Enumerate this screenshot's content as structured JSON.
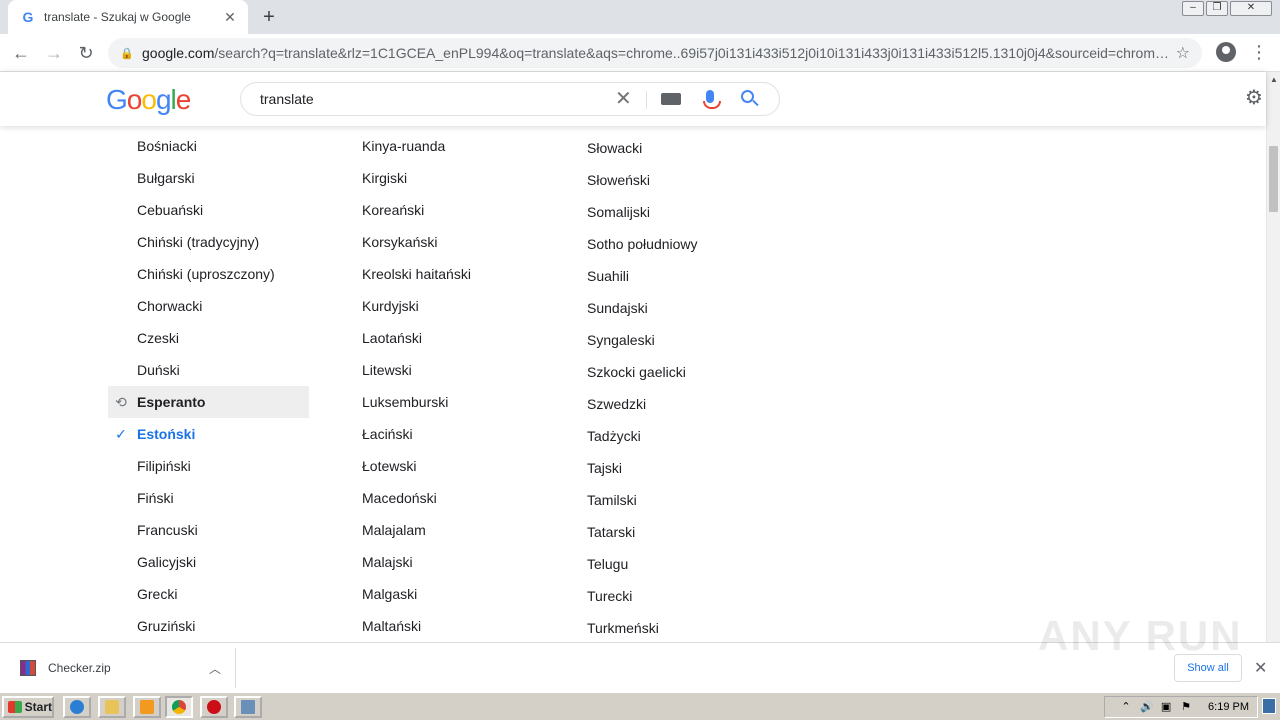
{
  "browser": {
    "tab_title": "translate - Szukaj w Google",
    "url_host": "google.com",
    "url_rest": "/search?q=translate&rlz=1C1GCEA_enPL994&oq=translate&aqs=chrome..69i57j0i131i433i512j0i10i131i433j0i131i433i512l5.1310j0j4&sourceid=chrom…",
    "window_controls": [
      "minimize",
      "restore",
      "close"
    ]
  },
  "search": {
    "query": "translate"
  },
  "languages": {
    "column1": [
      {
        "label": "Bośniacki"
      },
      {
        "label": "Bułgarski"
      },
      {
        "label": "Cebuański"
      },
      {
        "label": "Chiński (tradycyjny)"
      },
      {
        "label": "Chiński (uproszczony)"
      },
      {
        "label": "Chorwacki"
      },
      {
        "label": "Czeski"
      },
      {
        "label": "Duński"
      },
      {
        "label": "Esperanto",
        "state": "recent"
      },
      {
        "label": "Estoński",
        "state": "selected"
      },
      {
        "label": "Filipiński"
      },
      {
        "label": "Fiński"
      },
      {
        "label": "Francuski"
      },
      {
        "label": "Galicyjski"
      },
      {
        "label": "Grecki"
      },
      {
        "label": "Gruziński"
      }
    ],
    "column2": [
      {
        "label": "Kinya-ruanda"
      },
      {
        "label": "Kirgiski"
      },
      {
        "label": "Koreański"
      },
      {
        "label": "Korsykański"
      },
      {
        "label": "Kreolski haitański"
      },
      {
        "label": "Kurdyjski"
      },
      {
        "label": "Laotański"
      },
      {
        "label": "Litewski"
      },
      {
        "label": "Luksemburski"
      },
      {
        "label": "Łaciński"
      },
      {
        "label": "Łotewski"
      },
      {
        "label": "Macedoński"
      },
      {
        "label": "Malajalam"
      },
      {
        "label": "Malajski"
      },
      {
        "label": "Malgaski"
      },
      {
        "label": "Maltański"
      }
    ],
    "column3": [
      {
        "label": "Słowacki"
      },
      {
        "label": "Słoweński"
      },
      {
        "label": "Somalijski"
      },
      {
        "label": "Sotho południowy"
      },
      {
        "label": "Suahili"
      },
      {
        "label": "Sundajski"
      },
      {
        "label": "Syngaleski"
      },
      {
        "label": "Szkocki gaelicki"
      },
      {
        "label": "Szwedzki"
      },
      {
        "label": "Tadżycki"
      },
      {
        "label": "Tajski"
      },
      {
        "label": "Tamilski"
      },
      {
        "label": "Tatarski"
      },
      {
        "label": "Telugu"
      },
      {
        "label": "Turecki"
      },
      {
        "label": "Turkmeński"
      }
    ]
  },
  "downloads": {
    "file_name": "Checker.zip",
    "show_all_label": "Show all"
  },
  "taskbar": {
    "start_label": "Start",
    "clock": "6:19 PM"
  },
  "watermark": "ANY RUN",
  "colors": {
    "accent_blue": "#1a73e8",
    "recent_bg": "#eeeeee",
    "google_blue": "#4285f4",
    "google_red": "#ea4335",
    "google_yellow": "#fbbc05",
    "google_green": "#34a853"
  }
}
